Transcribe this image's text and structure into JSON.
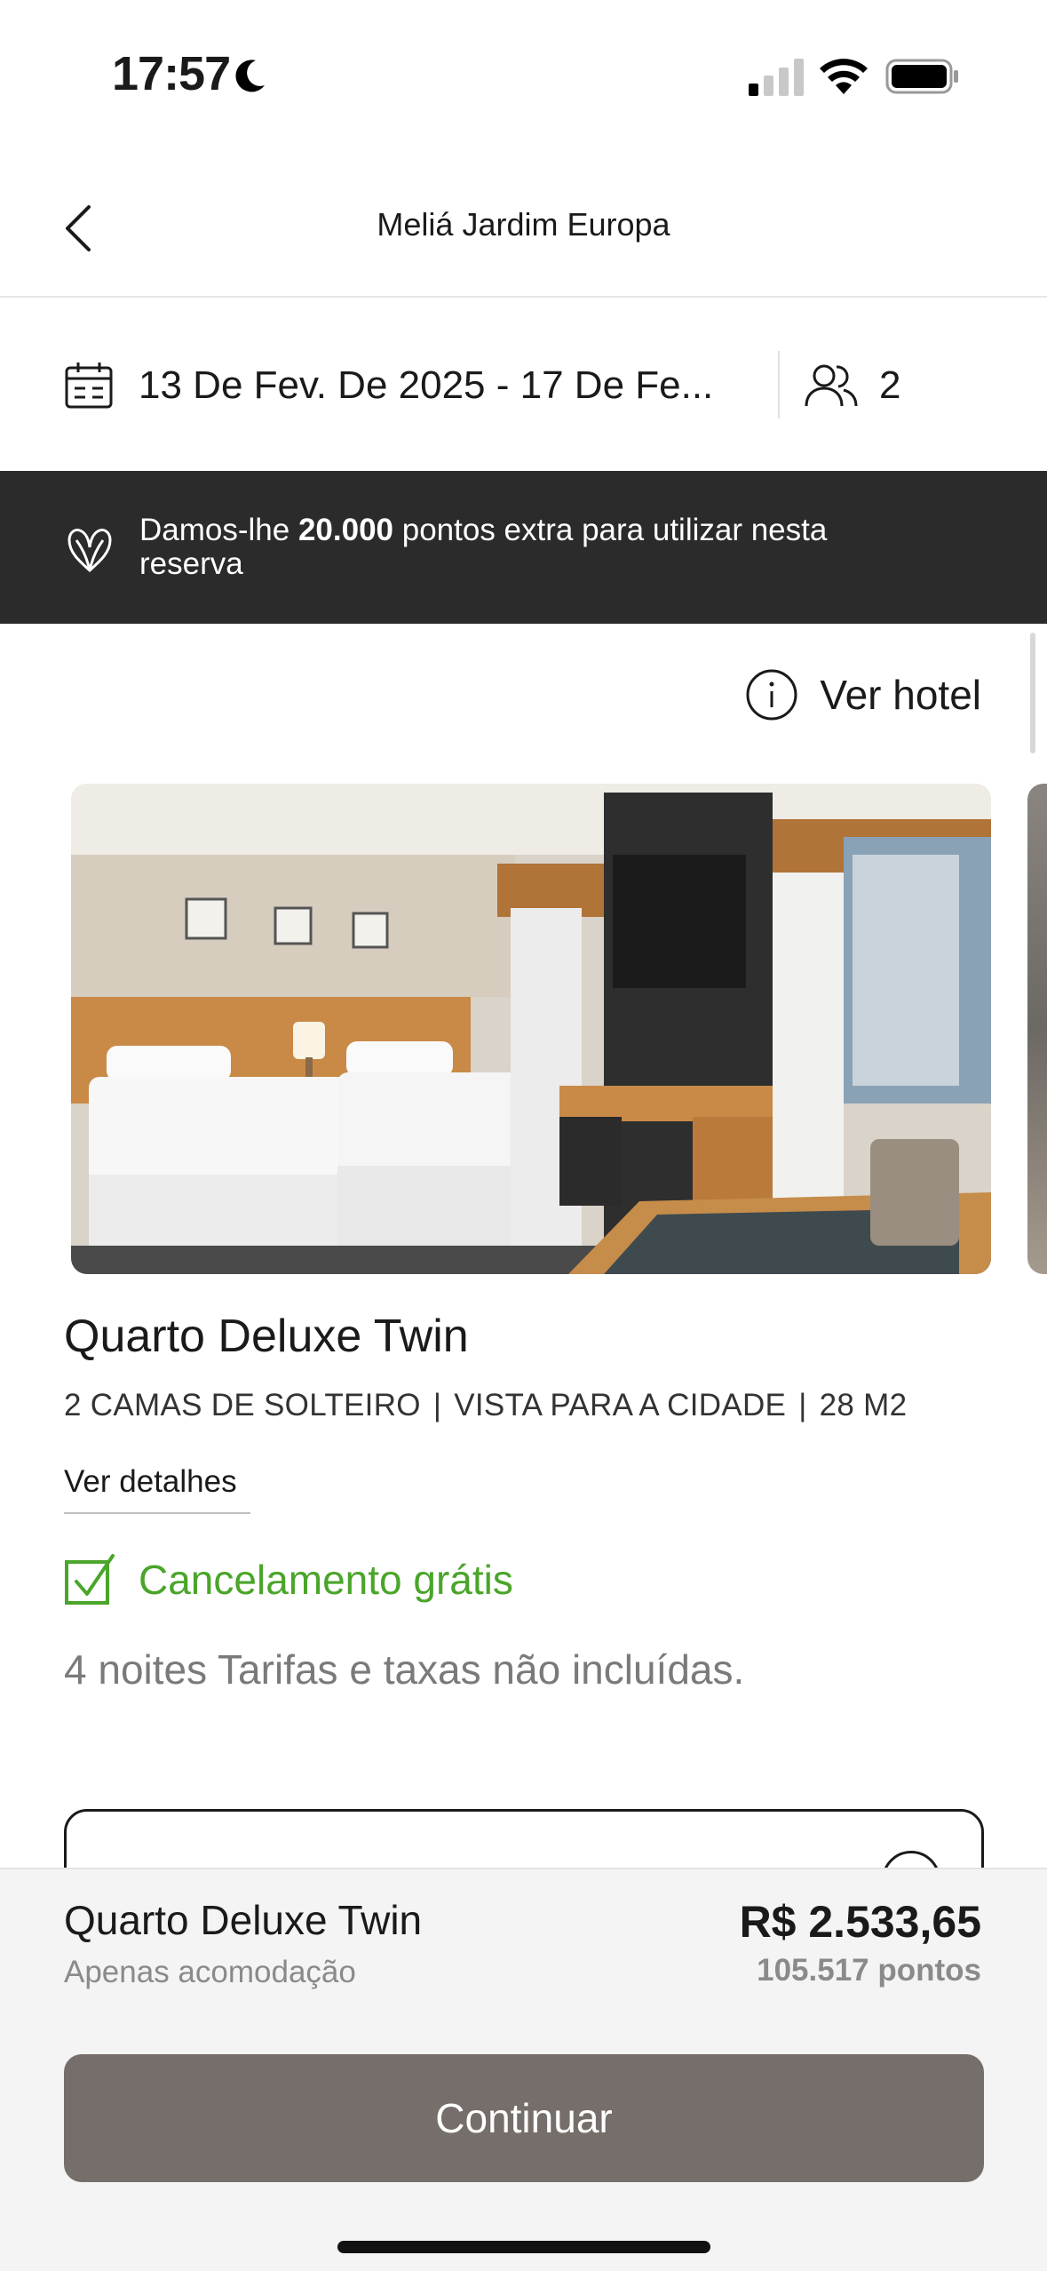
{
  "status_bar": {
    "time": "17:57",
    "icons": [
      "moon-icon",
      "cellular-signal-icon",
      "wifi-icon",
      "battery-icon"
    ]
  },
  "header": {
    "title": "Meliá Jardim Europa",
    "back_icon": "chevron-left-icon"
  },
  "search": {
    "dates": "13 De Fev. De 2025 - 17 De Fe...",
    "guests": "2"
  },
  "promo": {
    "prefix": "Damos-lhe ",
    "points": "20.000",
    "suffix": " pontos extra para utilizar nesta reserva"
  },
  "view_hotel": {
    "label": "Ver hotel"
  },
  "room": {
    "title": "Quarto Deluxe Twin",
    "features": [
      "2 CAMAS DE SOLTEIRO",
      "VISTA PARA A CIDADE",
      "28 M2"
    ],
    "feature_separator": "|",
    "details_link": "Ver detalhes",
    "cancellation": "Cancelamento grátis",
    "nights_note": "4 noites Tarifas e taxas não incluídas."
  },
  "summary": {
    "room": "Quarto Deluxe Twin",
    "board": "Apenas acomodação",
    "price": "R$ 2.533,65",
    "points": "105.517 pontos",
    "continue_label": "Continuar"
  },
  "colors": {
    "promo_bg": "#2b2b2b",
    "cancel_green": "#4aa52a",
    "continue_bg": "#766e6a",
    "sheet_bg": "#f4f4f4"
  }
}
